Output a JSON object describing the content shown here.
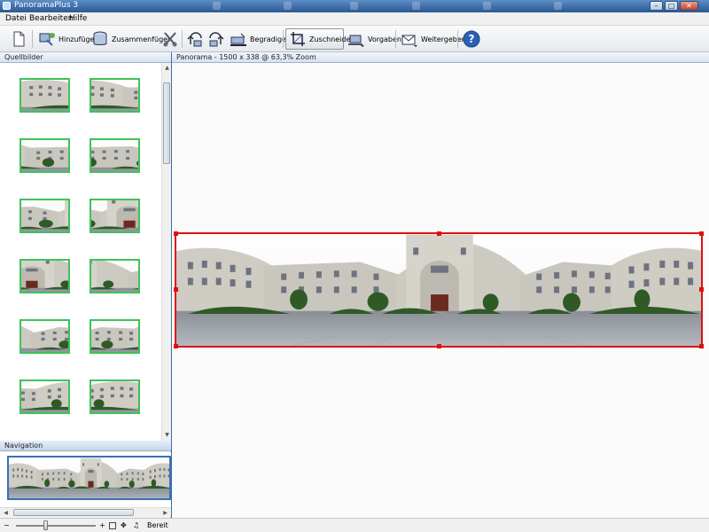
{
  "window": {
    "title": "PanoramaPlus 3",
    "controls": {
      "minimize": "–",
      "maximize": "□",
      "close": "✕"
    }
  },
  "menu": {
    "items": [
      "Datei",
      "Bearbeiten",
      "Hilfe"
    ]
  },
  "toolbar": {
    "buttons": [
      {
        "icon": "new-document-icon",
        "label": ""
      },
      {
        "icon": "add-images-icon",
        "label": "Hinzufügen"
      },
      {
        "icon": "merge-icon",
        "label": "Zusammenfügen"
      },
      {
        "icon": "delete-icon",
        "label": ""
      },
      {
        "icon": "rotate-left-icon",
        "label": ""
      },
      {
        "icon": "rotate-right-icon",
        "label": ""
      },
      {
        "icon": "straighten-icon",
        "label": "Begradigen"
      },
      {
        "icon": "crop-icon",
        "label": "Zuschneiden",
        "active": true
      },
      {
        "icon": "presets-icon",
        "label": "Vorgaben"
      },
      {
        "icon": "share-icon",
        "label": "Weitergeben"
      },
      {
        "icon": "help-icon",
        "label": "?"
      }
    ]
  },
  "left_panel": {
    "source_header": "Quellbilder",
    "thumbnail_count": 12,
    "navigation_header": "Navigation",
    "scroll_glyphs": {
      "up": "▲",
      "down": "▼",
      "left": "◀",
      "right": "▶"
    }
  },
  "main_panel": {
    "header": "Panorama - 1500 x 338 @ 63,3% Zoom"
  },
  "status": {
    "zoom_out": "−",
    "zoom_in": "+",
    "text": "Bereit"
  },
  "colors": {
    "selection_border": "#3fc25a",
    "crop_frame": "#e01010",
    "titlebar": "#3c6ca8"
  }
}
